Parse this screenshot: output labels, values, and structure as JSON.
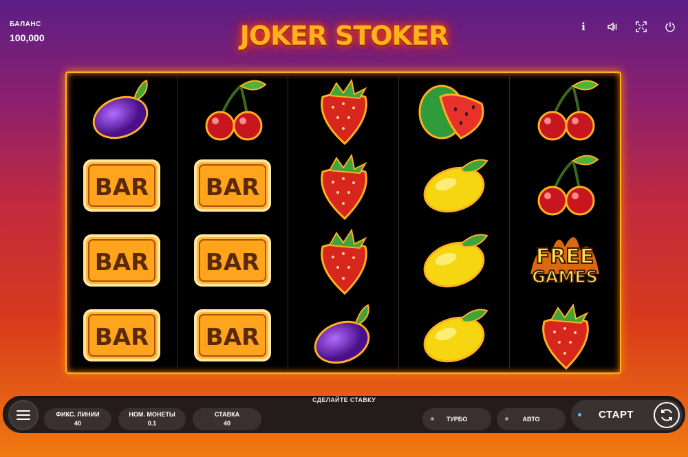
{
  "header": {
    "balance_label": "БАЛАНС",
    "balance_value": "100,000",
    "logo_text": "JOKER STOKER",
    "icons": [
      "info-icon",
      "sound-icon",
      "fullscreen-icon",
      "power-icon"
    ]
  },
  "reels": [
    [
      "plum",
      "bar",
      "bar",
      "bar"
    ],
    [
      "cherry",
      "bar",
      "bar",
      "bar"
    ],
    [
      "strawberry",
      "strawberry",
      "strawberry",
      "plum"
    ],
    [
      "watermelon",
      "lemon",
      "lemon",
      "lemon"
    ],
    [
      "cherry",
      "cherry",
      "free-games",
      "strawberry"
    ]
  ],
  "symbols": {
    "bar_text": "BAR",
    "free_line1": "FREE",
    "free_line2": "GAMES"
  },
  "controls": {
    "prompt": "СДЕЛАЙТЕ СТАВКУ",
    "lines_label": "ФИКС. ЛИНИИ",
    "lines_value": "40",
    "coin_label": "НОМ. МОНЕТЫ",
    "coin_value": "0.1",
    "bet_label": "СТАВКА",
    "bet_value": "40",
    "turbo_label": "ТУРБО",
    "auto_label": "АВТО",
    "start_label": "СТАРТ"
  },
  "colors": {
    "frame": "#ffb021",
    "logo": "#ffb21d",
    "start_dot": "#4fc3ff"
  }
}
